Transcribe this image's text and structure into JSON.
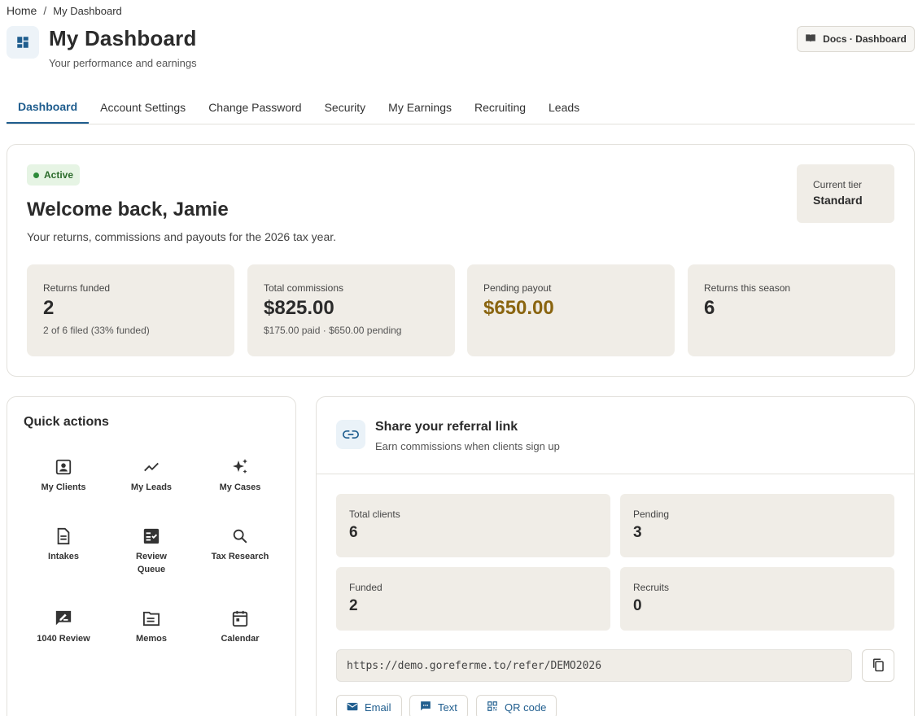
{
  "breadcrumb": {
    "home": "Home",
    "separator": "/",
    "current": "My Dashboard"
  },
  "header": {
    "title": "My Dashboard",
    "subtitle": "Your performance and earnings",
    "docs_label": "Docs · Dashboard",
    "accent": "#1f5d8e"
  },
  "tabs": [
    {
      "label": "Dashboard",
      "active": true
    },
    {
      "label": "Account Settings"
    },
    {
      "label": "Change Password"
    },
    {
      "label": "Security"
    },
    {
      "label": "My Earnings"
    },
    {
      "label": "Recruiting"
    },
    {
      "label": "Leads"
    }
  ],
  "welcome": {
    "status": "Active",
    "title": "Welcome back, Jamie",
    "subtitle": "Your returns, commissions and payouts for the 2026 tax year.",
    "tier_label": "Current tier",
    "tier_value": "Standard"
  },
  "stats": [
    {
      "label": "Returns funded",
      "value": "2",
      "sub": "2 of 6 filed (33% funded)"
    },
    {
      "label": "Total commissions",
      "value": "$825.00",
      "sub": "$175.00 paid · $650.00 pending"
    },
    {
      "label": "Pending payout",
      "value": "$650.00",
      "sub": ""
    },
    {
      "label": "Returns this season",
      "value": "6",
      "sub": ""
    }
  ],
  "quick_actions": {
    "title": "Quick actions",
    "items": [
      {
        "label": "My Clients",
        "icon": "contact-icon"
      },
      {
        "label": "My Leads",
        "icon": "trend-icon"
      },
      {
        "label": "My Cases",
        "icon": "sparkle-icon"
      },
      {
        "label": "Intakes",
        "icon": "document-icon"
      },
      {
        "label": "Review Queue",
        "icon": "checklist-icon"
      },
      {
        "label": "Tax Research",
        "icon": "search-icon"
      },
      {
        "label": "1040 Review",
        "icon": "rate-review-icon"
      },
      {
        "label": "Memos",
        "icon": "folder-icon"
      },
      {
        "label": "Calendar",
        "icon": "calendar-icon"
      }
    ]
  },
  "referral": {
    "title": "Share your referral link",
    "subtitle": "Earn commissions when clients sign up",
    "stats": [
      {
        "label": "Total clients",
        "value": "6"
      },
      {
        "label": "Pending",
        "value": "3"
      },
      {
        "label": "Funded",
        "value": "2"
      },
      {
        "label": "Recruits",
        "value": "0"
      }
    ],
    "url": "https://demo.goreferme.to/refer/DEMO2026",
    "buttons": {
      "email": "Email",
      "text": "Text",
      "qr": "QR code"
    }
  }
}
